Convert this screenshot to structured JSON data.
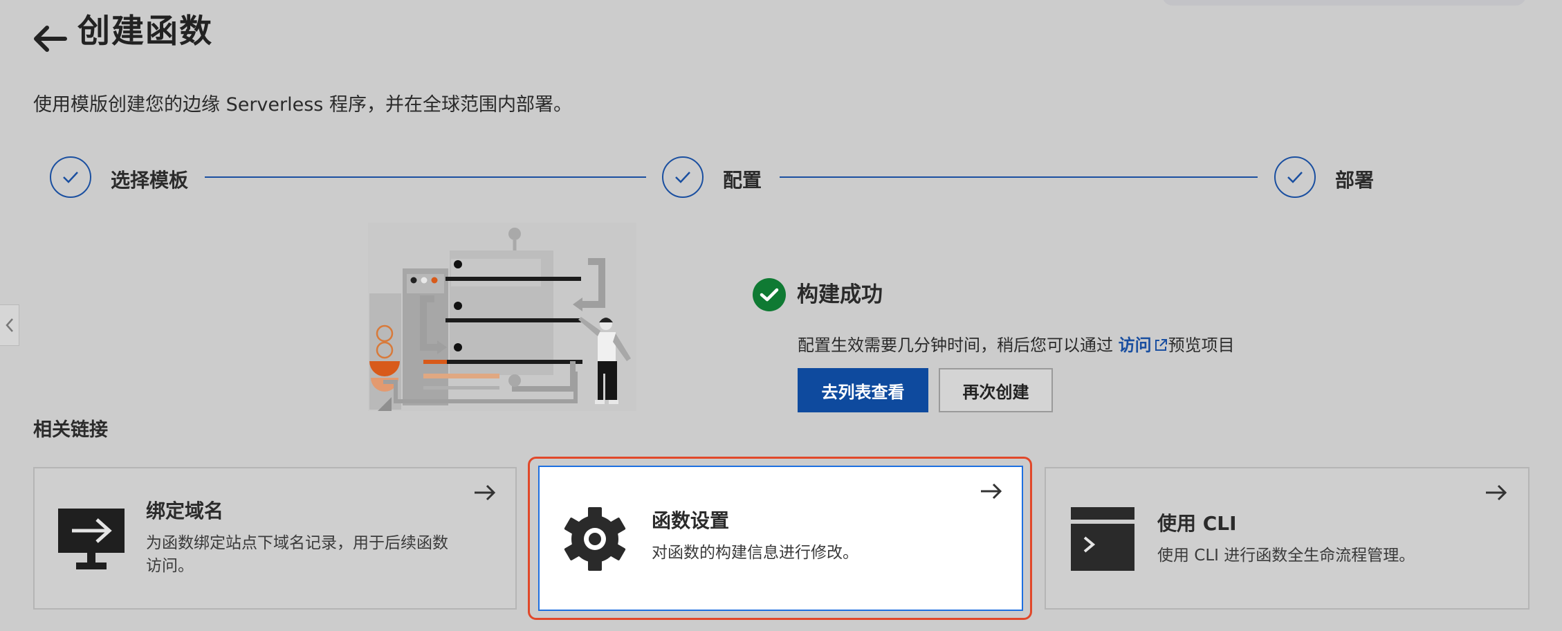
{
  "header": {
    "title": "创建函数",
    "description": "使用模版创建您的边缘 Serverless 程序，并在全球范围内部署。"
  },
  "steps": [
    {
      "label": "选择模板",
      "status": "done"
    },
    {
      "label": "配置",
      "status": "done"
    },
    {
      "label": "部署",
      "status": "done"
    }
  ],
  "result": {
    "title": "构建成功",
    "desc_before": "配置生效需要几分钟时间，稍后您可以通过 ",
    "link_label": "访问",
    "desc_after": "预览项目",
    "primary_button": "去列表查看",
    "secondary_button": "再次创建"
  },
  "related": {
    "title": "相关链接",
    "cards": [
      {
        "title": "绑定域名",
        "desc_line1": "为函数绑定站点下域名记录，用于后续函数",
        "desc_line2": "访问。",
        "icon": "monitor-arrow-icon"
      },
      {
        "title": "函数设置",
        "desc_line1": "对函数的构建信息进行修改。",
        "icon": "gear-icon"
      },
      {
        "title": "使用 CLI",
        "desc_line1": "使用 CLI 进行函数全生命流程管理。",
        "icon": "terminal-icon"
      }
    ]
  },
  "colors": {
    "accent": "#1a4fa0",
    "primary_button": "#0e4a9e",
    "success": "#0f7a33",
    "highlight": "#e1482a",
    "active_card_border": "#1d6fe0"
  }
}
